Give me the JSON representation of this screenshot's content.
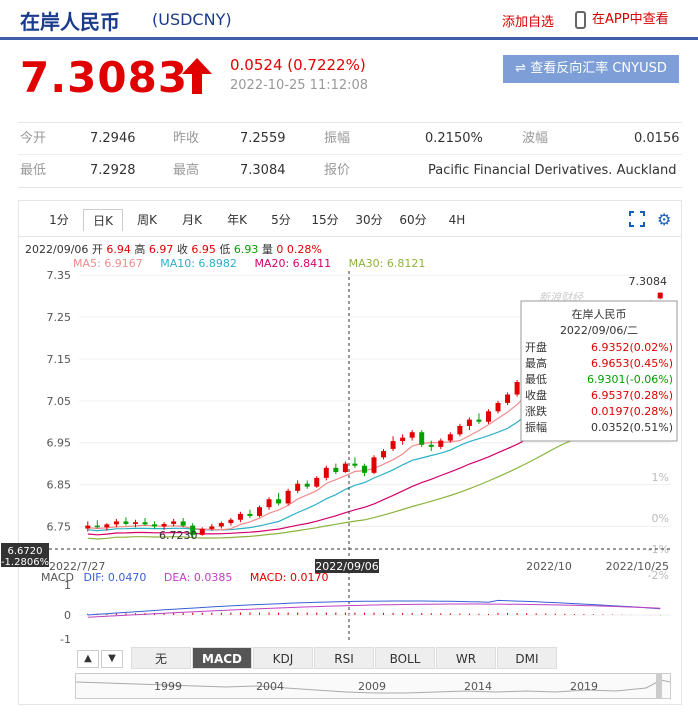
{
  "header": {
    "title": "在岸人民币",
    "code": "(USDCNY)",
    "add_watchlist": "添加自选",
    "app_view": "在APP中查看"
  },
  "quote": {
    "price": "7.3083",
    "change": "0.0524 (0.7222%)",
    "timestamp": "2022-10-25 11:12:08",
    "reverse_button": "查看反向汇率 CNYUSD"
  },
  "stats": {
    "open_label": "今开",
    "open": "7.2946",
    "prev_close_label": "昨收",
    "prev_close": "7.2559",
    "amplitude_label": "振幅",
    "amplitude": "0.2150%",
    "volatility_label": "波幅",
    "volatility": "0.0156",
    "low_label": "最低",
    "low": "7.2928",
    "high_label": "最高",
    "high": "7.3084",
    "quote_label": "报价",
    "quote_source": "Pacific Financial Derivatives. Auckland"
  },
  "period_tabs": [
    "1分",
    "日K",
    "周K",
    "月K",
    "年K",
    "5分",
    "15分",
    "30分",
    "60分",
    "4H"
  ],
  "active_period": "日K",
  "ohlc_line": {
    "date": "2022/09/06",
    "open_label": "开",
    "open": "6.94",
    "high_label": "高",
    "high": "6.97",
    "close_label": "收",
    "close": "6.95",
    "low_label": "低",
    "low": "6.93",
    "vol_label": "量",
    "vol": "0",
    "pct": "0.28%"
  },
  "ma_line": {
    "ma5": "MA5: 6.9167",
    "ma10": "MA10: 6.8982",
    "ma20": "MA20: 6.8411",
    "ma30": "MA30: 6.8121"
  },
  "colors": {
    "up": "#e00000",
    "down": "#00a000",
    "ma5": "#f08c8c",
    "ma10": "#2bb0c8",
    "ma20": "#d4006a",
    "ma30": "#8cb43c"
  },
  "tooltip": {
    "title": "在岸人民币",
    "date": "2022/09/06/二",
    "rows": [
      {
        "label": "开盘",
        "value": "6.9352(0.02%)",
        "color": "#e00000"
      },
      {
        "label": "最高",
        "value": "6.9653(0.45%)",
        "color": "#e00000"
      },
      {
        "label": "最低",
        "value": "6.9301(-0.06%)",
        "color": "#00a000"
      },
      {
        "label": "收盘",
        "value": "6.9537(0.28%)",
        "color": "#e00000"
      },
      {
        "label": "涨跌",
        "value": "0.0197(0.28%)",
        "color": "#e00000"
      },
      {
        "label": "振幅",
        "value": "0.0352(0.51%)",
        "color": "#333"
      }
    ]
  },
  "watermark": "新浪财经",
  "macd": {
    "label": "MACD",
    "dif": "DIF: 0.0470",
    "dea": "DEA: 0.0385",
    "macd": "MACD: 0.0170",
    "y_ticks": [
      "1",
      "0",
      "-1"
    ]
  },
  "indicator_tabs": [
    "无",
    "MACD",
    "KDJ",
    "RSI",
    "BOLL",
    "WR",
    "DMI"
  ],
  "active_indicator": "MACD",
  "timeline_years": [
    "1999",
    "2004",
    "2009",
    "2014",
    "2019"
  ],
  "chart_data": {
    "type": "candlestick",
    "y_ticks": [
      "7.35",
      "7.25",
      "7.15",
      "7.05",
      "6.95",
      "6.85",
      "6.75"
    ],
    "ylim": [
      6.72,
      7.36
    ],
    "right_ticks": [
      "1%",
      "0%",
      "-1%",
      "-2%"
    ],
    "x_labels": [
      "2022/7/27",
      "2022/09/06",
      "2022/10",
      "2022/10/25"
    ],
    "last_price_label": "7.3084",
    "min_label": "6.7230",
    "crosshair_price": "6.6720",
    "crosshair_pct": "-1.2806%",
    "candles": [
      [
        6.745,
        6.762,
        6.738,
        6.752
      ],
      [
        6.752,
        6.765,
        6.745,
        6.748
      ],
      [
        6.748,
        6.758,
        6.74,
        6.755
      ],
      [
        6.755,
        6.768,
        6.748,
        6.762
      ],
      [
        6.762,
        6.772,
        6.752,
        6.756
      ],
      [
        6.756,
        6.766,
        6.748,
        6.76
      ],
      [
        6.76,
        6.77,
        6.752,
        6.755
      ],
      [
        6.755,
        6.762,
        6.744,
        6.75
      ],
      [
        6.75,
        6.76,
        6.742,
        6.756
      ],
      [
        6.756,
        6.768,
        6.75,
        6.762
      ],
      [
        6.762,
        6.77,
        6.748,
        6.752
      ],
      [
        6.752,
        6.758,
        6.723,
        6.73
      ],
      [
        6.73,
        6.748,
        6.728,
        6.744
      ],
      [
        6.744,
        6.756,
        6.74,
        6.75
      ],
      [
        6.75,
        6.762,
        6.745,
        6.758
      ],
      [
        6.758,
        6.77,
        6.752,
        6.766
      ],
      [
        6.766,
        6.785,
        6.76,
        6.78
      ],
      [
        6.78,
        6.79,
        6.77,
        6.775
      ],
      [
        6.775,
        6.8,
        6.772,
        6.796
      ],
      [
        6.796,
        6.82,
        6.79,
        6.815
      ],
      [
        6.815,
        6.83,
        6.8,
        6.805
      ],
      [
        6.805,
        6.84,
        6.8,
        6.835
      ],
      [
        6.835,
        6.86,
        6.83,
        6.852
      ],
      [
        6.852,
        6.86,
        6.84,
        6.845
      ],
      [
        6.845,
        6.87,
        6.842,
        6.866
      ],
      [
        6.866,
        6.895,
        6.86,
        6.89
      ],
      [
        6.89,
        6.9,
        6.875,
        6.88
      ],
      [
        6.88,
        6.905,
        6.878,
        6.9
      ],
      [
        6.9,
        6.915,
        6.89,
        6.895
      ],
      [
        6.895,
        6.9,
        6.87,
        6.878
      ],
      [
        6.878,
        6.92,
        6.875,
        6.915
      ],
      [
        6.915,
        6.935,
        6.91,
        6.93
      ],
      [
        6.9352,
        6.9653,
        6.9301,
        6.9537
      ],
      [
        6.954,
        6.97,
        6.945,
        6.962
      ],
      [
        6.962,
        6.98,
        6.955,
        6.975
      ],
      [
        6.975,
        6.98,
        6.94,
        6.945
      ],
      [
        6.945,
        6.955,
        6.93,
        6.94
      ],
      [
        6.94,
        6.96,
        6.935,
        6.955
      ],
      [
        6.955,
        6.975,
        6.95,
        6.97
      ],
      [
        6.97,
        6.995,
        6.965,
        6.99
      ],
      [
        6.99,
        7.01,
        6.98,
        7.005
      ],
      [
        7.005,
        7.02,
        6.995,
        7.0
      ],
      [
        7.0,
        7.03,
        6.995,
        7.025
      ],
      [
        7.025,
        7.05,
        7.02,
        7.045
      ],
      [
        7.045,
        7.07,
        7.04,
        7.065
      ],
      [
        7.065,
        7.1,
        7.06,
        7.095
      ],
      [
        7.095,
        7.12,
        7.085,
        7.115
      ],
      [
        7.115,
        7.14,
        7.1,
        7.135
      ],
      [
        7.135,
        7.16,
        7.125,
        7.155
      ],
      [
        7.155,
        7.25,
        7.15,
        7.2
      ],
      [
        7.2,
        7.22,
        7.13,
        7.14
      ],
      [
        7.14,
        7.15,
        7.09,
        7.1
      ],
      [
        7.1,
        7.13,
        7.09,
        7.12
      ],
      [
        7.12,
        7.15,
        7.11,
        7.14
      ],
      [
        7.14,
        7.17,
        7.13,
        7.16
      ],
      [
        7.16,
        7.2,
        7.15,
        7.19
      ],
      [
        7.19,
        7.22,
        7.18,
        7.21
      ],
      [
        7.21,
        7.25,
        7.2,
        7.24
      ],
      [
        7.24,
        7.27,
        7.23,
        7.26
      ],
      [
        7.26,
        7.29,
        7.25,
        7.28
      ],
      [
        7.2946,
        7.3084,
        7.2928,
        7.3083
      ]
    ]
  }
}
